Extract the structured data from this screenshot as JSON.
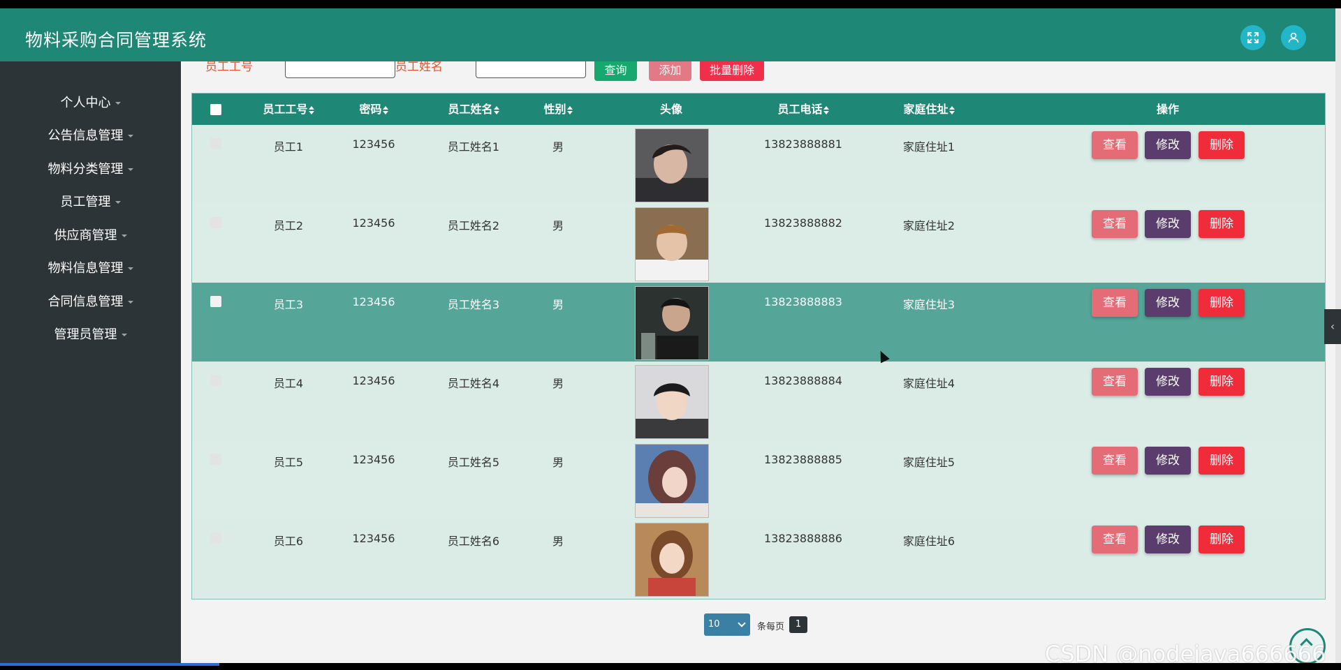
{
  "app": {
    "title": "物料采购合同管理系统"
  },
  "sidebar": {
    "items": [
      {
        "label": "个人中心"
      },
      {
        "label": "公告信息管理"
      },
      {
        "label": "物料分类管理"
      },
      {
        "label": "员工管理"
      },
      {
        "label": "供应商管理"
      },
      {
        "label": "物料信息管理"
      },
      {
        "label": "合同信息管理"
      },
      {
        "label": "管理员管理"
      }
    ]
  },
  "search": {
    "label_id": "员工工号",
    "label_name": "员工姓名",
    "btn_search": "查询",
    "btn_add": "添加",
    "btn_batch_delete": "批量删除"
  },
  "table": {
    "columns": [
      "员工工号",
      "密码",
      "员工姓名",
      "性别",
      "头像",
      "员工电话",
      "家庭住址",
      "操作"
    ],
    "rows": [
      {
        "id": "员工1",
        "password": "123456",
        "name": "员工姓名1",
        "gender": "男",
        "phone": "13823888881",
        "address": "家庭住址1"
      },
      {
        "id": "员工2",
        "password": "123456",
        "name": "员工姓名2",
        "gender": "男",
        "phone": "13823888882",
        "address": "家庭住址2"
      },
      {
        "id": "员工3",
        "password": "123456",
        "name": "员工姓名3",
        "gender": "男",
        "phone": "13823888883",
        "address": "家庭住址3"
      },
      {
        "id": "员工4",
        "password": "123456",
        "name": "员工姓名4",
        "gender": "男",
        "phone": "13823888884",
        "address": "家庭住址4"
      },
      {
        "id": "员工5",
        "password": "123456",
        "name": "员工姓名5",
        "gender": "男",
        "phone": "13823888885",
        "address": "家庭住址5"
      },
      {
        "id": "员工6",
        "password": "123456",
        "name": "员工姓名6",
        "gender": "男",
        "phone": "13823888886",
        "address": "家庭住址6"
      }
    ],
    "actions": {
      "view": "查看",
      "edit": "修改",
      "delete": "删除"
    }
  },
  "pagination": {
    "page_size": "10",
    "per_page_label": "条每页",
    "current_page": "1"
  },
  "watermark": "CSDN @nodejava666666",
  "colors": {
    "header": "#1f8776",
    "sidebar": "#2c3438",
    "row_highlight": "#55a699",
    "row_bg": "#dbece7"
  }
}
